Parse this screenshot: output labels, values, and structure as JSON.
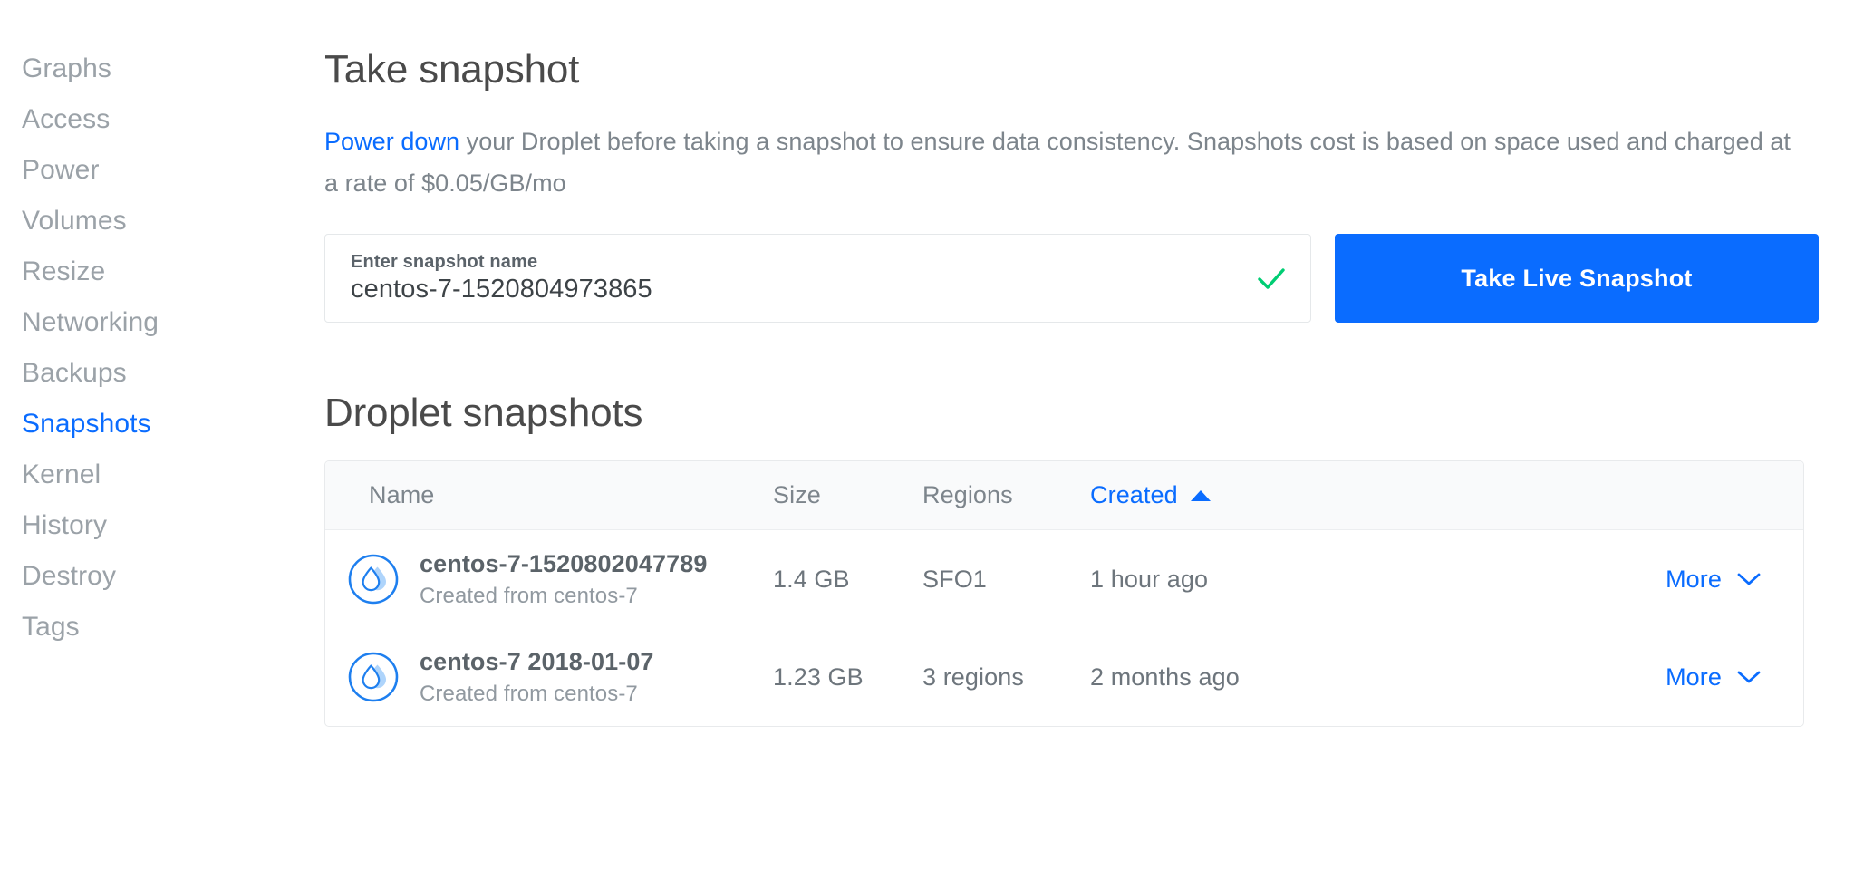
{
  "sidebar": {
    "items": [
      {
        "label": "Graphs",
        "active": false
      },
      {
        "label": "Access",
        "active": false
      },
      {
        "label": "Power",
        "active": false
      },
      {
        "label": "Volumes",
        "active": false
      },
      {
        "label": "Resize",
        "active": false
      },
      {
        "label": "Networking",
        "active": false
      },
      {
        "label": "Backups",
        "active": false
      },
      {
        "label": "Snapshots",
        "active": true
      },
      {
        "label": "Kernel",
        "active": false
      },
      {
        "label": "History",
        "active": false
      },
      {
        "label": "Destroy",
        "active": false
      },
      {
        "label": "Tags",
        "active": false
      }
    ]
  },
  "main": {
    "title": "Take snapshot",
    "description": {
      "link_text": "Power down",
      "rest": " your Droplet before taking a snapshot to ensure data consistency. Snapshots cost is based on space used and charged at a rate of $0.05/GB/mo"
    },
    "snapshot_field": {
      "label": "Enter snapshot name",
      "value": "centos-7-1520804973865",
      "placeholder": "Enter snapshot name",
      "valid": true
    },
    "take_snapshot_button": "Take Live Snapshot",
    "section_title": "Droplet snapshots",
    "table": {
      "columns": [
        "Name",
        "Size",
        "Regions",
        "Created"
      ],
      "sorted_column": "Created",
      "sort_direction": "asc",
      "more_label": "More",
      "rows": [
        {
          "name": "centos-7-1520802047789",
          "subtitle": "Created from centos-7",
          "size": "1.4 GB",
          "regions": "SFO1",
          "created": "1 hour ago"
        },
        {
          "name": "centos-7 2018-01-07",
          "subtitle": "Created from centos-7",
          "size": "1.23 GB",
          "regions": "3 regions",
          "created": "2 months ago"
        }
      ]
    }
  },
  "colors": {
    "accent_blue": "#0a6cff",
    "success_green": "#00cd73",
    "muted_text": "#9ba2a8",
    "heading_text": "#4a4a4a",
    "header_bg": "#f9fafb"
  }
}
